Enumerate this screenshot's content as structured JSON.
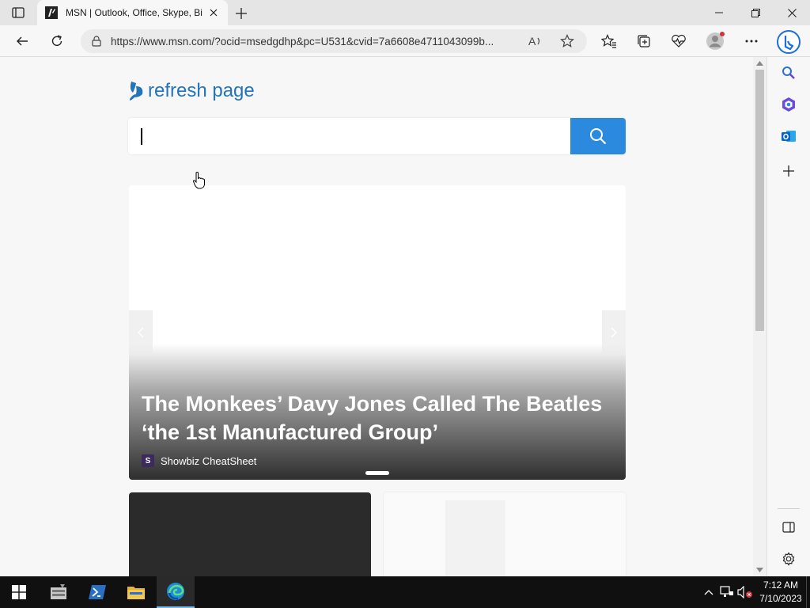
{
  "browser": {
    "tab_title": "MSN | Outlook, Office, Skype, Bing",
    "address": "https://www.msn.com/?ocid=msedgdhp&pc=U531&cvid=7a6608e4711043099b..."
  },
  "page": {
    "brand_text": "refresh page",
    "search_placeholder": "",
    "hero": {
      "title": "The Monkees’ Davy Jones Called The Beatles ‘the 1st Manufactured Group’",
      "source": "Showbiz CheatSheet",
      "source_initial": "S"
    }
  },
  "taskbar": {
    "time": "7:12 AM",
    "date": "7/10/2023"
  },
  "colors": {
    "accent": "#2b8ade",
    "brand_blue": "#2275b9",
    "taskbar": "#101010"
  },
  "icons": [
    "tab-actions-icon",
    "msn-favicon",
    "close-icon",
    "plus-icon",
    "minimize-icon",
    "restore-icon",
    "back-icon",
    "refresh-icon",
    "lock-icon",
    "read-aloud-icon",
    "favorite-star-icon",
    "favorites-icon",
    "collections-icon",
    "heartbeat-icon",
    "profile-icon",
    "more-icon",
    "bing-icon",
    "search-icon",
    "office-icon",
    "outlook-icon",
    "sidebar-toggle-icon",
    "settings-icon",
    "windows-start-icon",
    "server-manager-icon",
    "powershell-icon",
    "file-explorer-icon",
    "edge-icon"
  ]
}
